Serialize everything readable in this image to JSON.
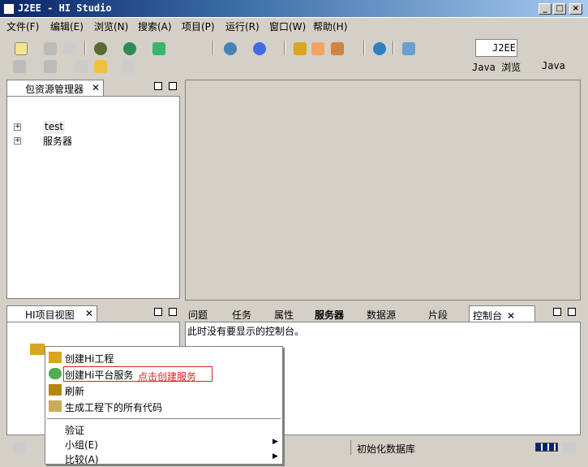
{
  "title": "J2EE  -  HI Studio",
  "menu": [
    "文件(F)",
    "编辑(E)",
    "浏览(N)",
    "搜索(A)",
    "项目(P)",
    "运行(R)",
    "窗口(W)",
    "帮助(H)"
  ],
  "perspectives": {
    "j2ee": "J2EE",
    "java_browse": "Java 浏览",
    "java": "Java"
  },
  "package_explorer": {
    "title": "包资源管理器",
    "items": [
      "test",
      "服务器"
    ]
  },
  "hi_project_view": {
    "title": "HI项目视图"
  },
  "bottom_tabs": [
    "问题",
    "任务",
    "属性",
    "服务器",
    "数据源",
    "片段",
    "控制台"
  ],
  "console_message": "此时没有要显示的控制台。",
  "context_menu": {
    "items": [
      "创建Hi工程",
      "创建Hi平台服务",
      "刷新",
      "生成工程下的所有代码",
      "验证",
      "小组(E)",
      "比较(A)"
    ],
    "annotation": "点击创建服务"
  },
  "status": {
    "task": "初始化数据库"
  }
}
